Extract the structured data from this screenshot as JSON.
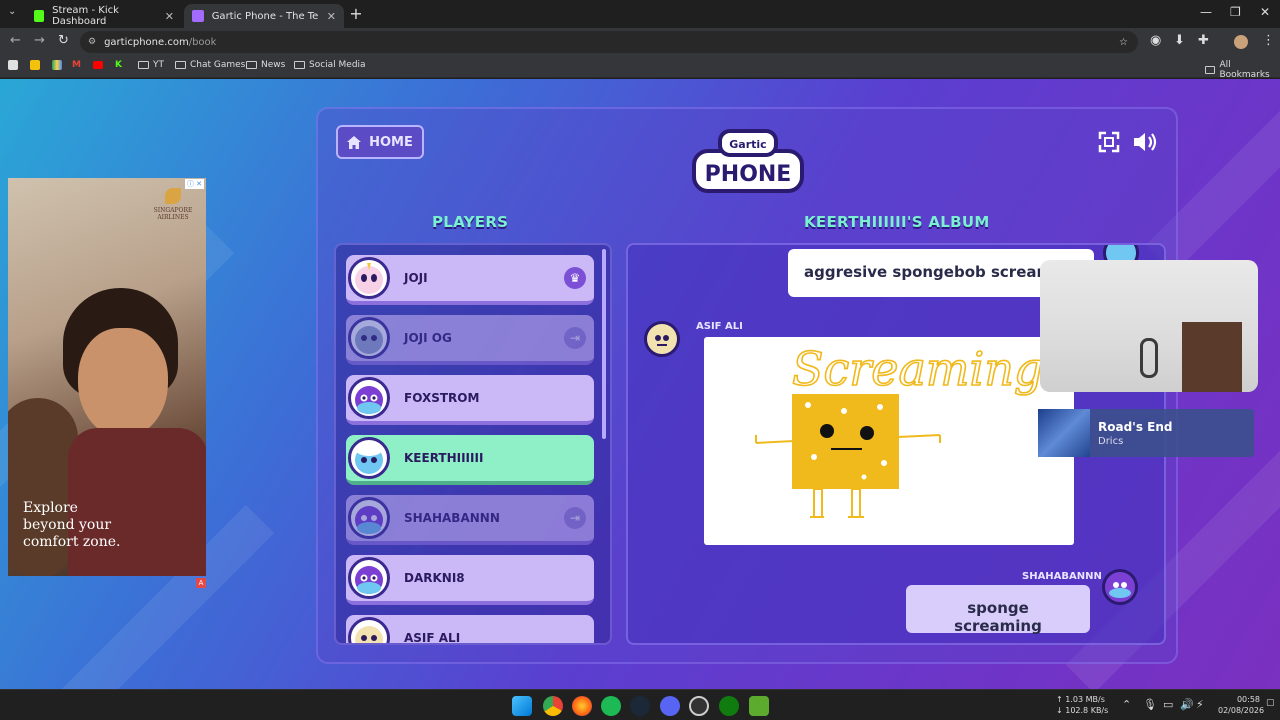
{
  "browser": {
    "tabs": [
      {
        "title": "Stream - Kick Dashboard",
        "favicon_color": "#53fc18"
      },
      {
        "title": "Gartic Phone - The Telephone G",
        "favicon_color": "#a46bff"
      }
    ],
    "url_host": "garticphone.com",
    "url_path": "/book",
    "bookmarks": [
      {
        "label": "YT",
        "type": "folder"
      },
      {
        "label": "Chat Games",
        "type": "folder"
      },
      {
        "label": "News",
        "type": "folder"
      },
      {
        "label": "Social Media",
        "type": "folder"
      }
    ],
    "all_bookmarks": "All Bookmarks"
  },
  "ad": {
    "brand_line1": "SINGAPORE",
    "brand_line2": "AIRLINES",
    "tagline_1": "Explore",
    "tagline_2": "beyond your",
    "tagline_3": "comfort zone.",
    "info": "ⓘ ✕"
  },
  "game": {
    "home_label": "HOME",
    "logo_top": "Gartic",
    "logo_main": "PHONE",
    "players_title": "PLAYERS",
    "album_title": "KEERTHIIIIII'S ALBUM",
    "players": [
      {
        "name": "JOJI",
        "state": "host",
        "avatar_color": "#f3b4d9"
      },
      {
        "name": "JOJI OG",
        "state": "left",
        "avatar_color": "#8aa0c8"
      },
      {
        "name": "FOXSTROM",
        "state": "normal",
        "avatar_color": "#7b3fd4"
      },
      {
        "name": "KEERTHIIIIII",
        "state": "current",
        "avatar_color": "#6fc7f2"
      },
      {
        "name": "SHAHABANNN",
        "state": "left",
        "avatar_color": "#7b3fd4"
      },
      {
        "name": "DARKNI8",
        "state": "normal",
        "avatar_color": "#7b3fd4"
      },
      {
        "name": "ASIF ALI",
        "state": "normal",
        "avatar_color": "#f2e2b0"
      }
    ],
    "album": {
      "first_phrase": "aggresive spongebob scream",
      "drawer_name": "ASIF ALI",
      "drawing_word": "Screaming",
      "answer_name": "SHAHABANNN",
      "answer_text": "sponge screaming"
    }
  },
  "overlay": {
    "song_title": "Road's End",
    "song_artist": "Drics"
  },
  "taskbar": {
    "net_up": "↑ 1.03 MB/s",
    "net_down": "↓ 102.8 KB/s",
    "time": "00:58",
    "date": "02/08/2026"
  }
}
